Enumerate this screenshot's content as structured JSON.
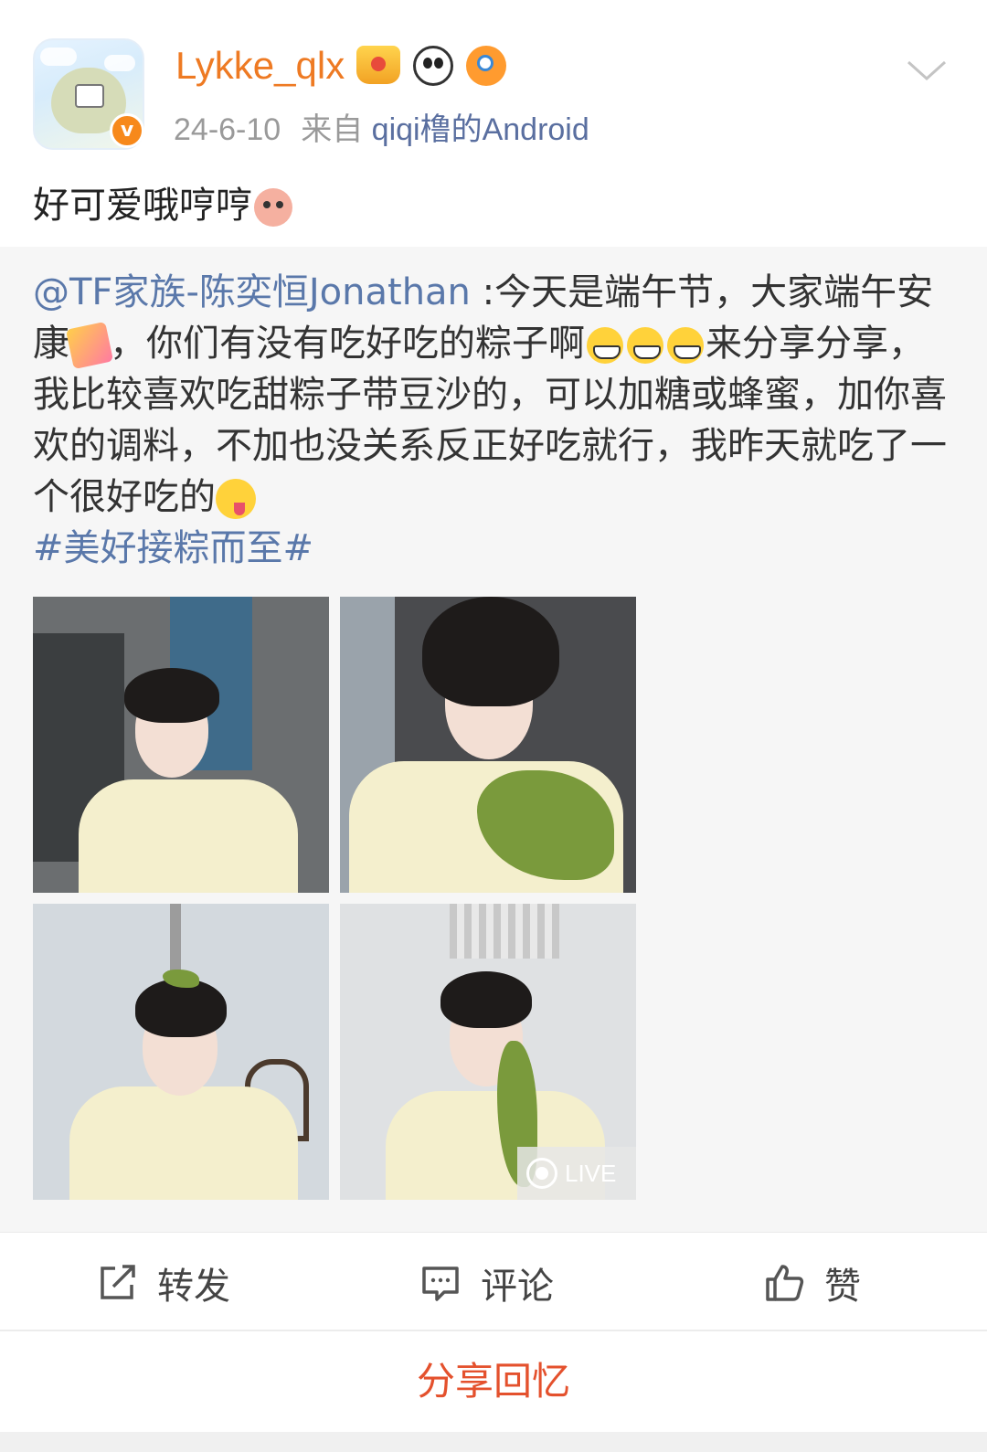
{
  "post": {
    "username": "Lykke_qlx",
    "date": "24-6-10",
    "source_prefix": "来自",
    "source": "qiqi橹的Android",
    "verified_mark": "v",
    "text": "好可爱哦哼哼",
    "badges": [
      "crown-badge-icon",
      "panda-badge-icon",
      "fish-badge-icon"
    ]
  },
  "repost": {
    "mention": "@TF家族-陈奕恒Jonathan",
    "part1": " :今天是端午节，大家端午安康",
    "part2": "，你们有没有吃好吃的粽子啊",
    "part3": "来分享分享，我比较喜欢吃甜粽子带豆沙的，可以加糖或蜂蜜，加你喜欢的调料，不加也没关系反正好吃就行，我昨天就吃了一个很好吃的",
    "hashtag": "#美好接粽而至#",
    "live_label": "LIVE"
  },
  "actions": {
    "repost": "转发",
    "comment": "评论",
    "like": "赞"
  },
  "share_memory": "分享回忆",
  "colors": {
    "username": "#ee7a23",
    "link": "#5a78aa",
    "share": "#e4512d"
  }
}
